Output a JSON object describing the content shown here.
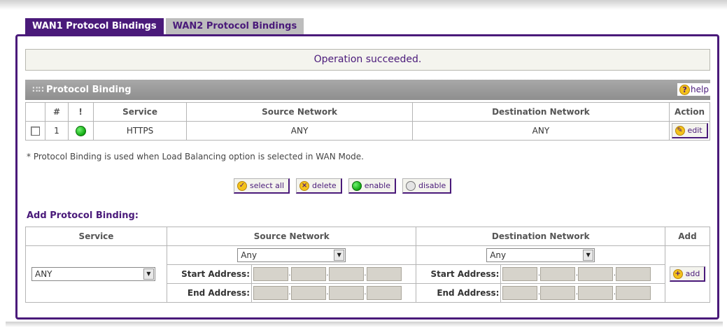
{
  "tabs": [
    {
      "label": "WAN1 Protocol Bindings",
      "active": true
    },
    {
      "label": "WAN2 Protocol Bindings",
      "active": false
    }
  ],
  "status_message": "Operation succeeded.",
  "protocol_binding": {
    "title": "Protocol Binding",
    "help_label": "help",
    "columns": [
      "#",
      "!",
      "Service",
      "Source Network",
      "Destination Network",
      "Action"
    ],
    "rows": [
      {
        "index": "1",
        "status": "enabled",
        "service": "HTTPS",
        "source": "ANY",
        "destination": "ANY",
        "action": "edit"
      }
    ],
    "note": "* Protocol Binding is used when Load Balancing option is selected in WAN Mode.",
    "buttons": {
      "select_all": "select all",
      "delete": "delete",
      "enable": "enable",
      "disable": "disable"
    }
  },
  "add_binding": {
    "title": "Add Protocol Binding:",
    "columns": [
      "Service",
      "Source Network",
      "Destination Network",
      "Add"
    ],
    "service_value": "ANY",
    "source_value": "Any",
    "destination_value": "Any",
    "start_label": "Start Address:",
    "end_label": "End Address:",
    "add_button": "add"
  },
  "colors": {
    "accent": "#4a1a7a",
    "header_gray": "#9a9a9a",
    "status_on": "#11a811"
  }
}
